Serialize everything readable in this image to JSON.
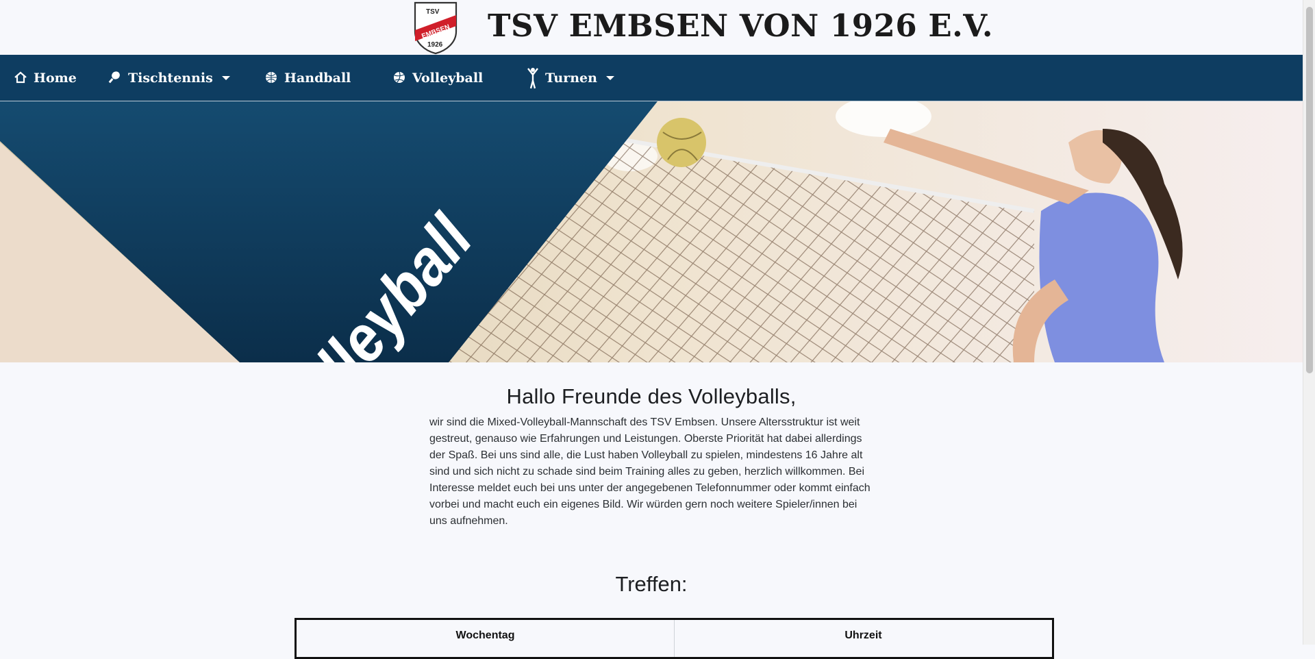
{
  "header": {
    "title": "TSV EMBSEN VON 1926 E.V.",
    "logo": {
      "top_text": "TSV",
      "band_text": "EMBSEN",
      "year": "1926",
      "band_color": "#d01f2a"
    }
  },
  "nav": {
    "background": "#0e3d61",
    "items": [
      {
        "label": "Home",
        "icon": "house-icon",
        "dropdown": false
      },
      {
        "label": "Tischtennis",
        "icon": "table-tennis-paddle-icon",
        "dropdown": true
      },
      {
        "label": "Handball",
        "icon": "handball-icon",
        "dropdown": false
      },
      {
        "label": "Volleyball",
        "icon": "volleyball-icon",
        "dropdown": false
      },
      {
        "label": "Turnen",
        "icon": "gymnast-icon",
        "dropdown": true
      }
    ]
  },
  "hero": {
    "banner_text": "Volleyball"
  },
  "intro": {
    "heading": "Hallo Freunde des Volleyballs,",
    "body": "wir sind die Mixed-Volleyball-Mannschaft des TSV Embsen. Unsere Altersstruktur ist weit gestreut, genauso wie Erfahrungen und Leistungen. Oberste Priorität hat dabei allerdings der Spaß. Bei uns sind alle, die Lust haben Volleyball zu spielen, mindestens 16 Jahre alt sind und sich nicht zu schade sind beim Training alles zu geben, herzlich willkommen. Bei Interesse meldet euch bei uns unter der angegebenen Telefonnummer oder kommt einfach vorbei und macht euch ein eigenes Bild. Wir würden gern noch weitere Spieler/innen bei uns aufnehmen."
  },
  "meetings": {
    "heading": "Treffen:",
    "columns": [
      "Wochentag",
      "Uhrzeit"
    ]
  }
}
